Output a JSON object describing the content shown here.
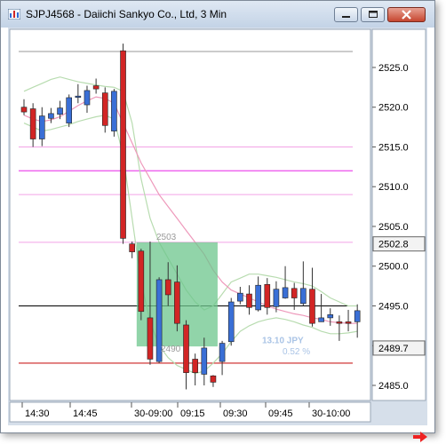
{
  "window": {
    "title": "SJPJ4568 - Daiichi Sankyo Co., Ltd, 3 Min"
  },
  "icons": {
    "app": "chart-icon",
    "minimize": "minimize-icon",
    "maximize": "maximize-icon",
    "close": "close-icon",
    "scroll_right": "arrow-right-icon"
  },
  "colors": {
    "up_candle": "#3a6fd6",
    "down_candle": "#d22525",
    "moving_average": "#ee99bb",
    "band": "#b8dcb0",
    "highlight_box": "#6cc58c",
    "resistance_line": "#ee66ee",
    "support_line": "#cc2222",
    "current_price_line": "#000000",
    "arrow": "#ee2222"
  },
  "price_axis": {
    "labels": [
      "2525.0",
      "2520.0",
      "2515.0",
      "2510.0",
      "2505.0",
      "2500.0",
      "2495.0",
      "2490.0",
      "2485.0"
    ],
    "current_price_label": "2502.8",
    "second_price_label": "2489.7"
  },
  "time_axis": {
    "labels": [
      "14:30",
      "14:45",
      "30-09:00",
      "09:15",
      "09:30",
      "09:45",
      "30-10:00"
    ]
  },
  "annotations": {
    "level_label": "2503",
    "box_low_label": "2490",
    "measure_label": "13.10 JPY",
    "measure_percent": "0.52 %"
  },
  "chart_data": {
    "type": "candlestick",
    "title": "SJPJ4568 - Daiichi Sankyo Co., Ltd, 3 Min",
    "xlabel": "",
    "ylabel": "",
    "ylim": [
      2483.1,
      2529.8
    ],
    "y_ticks": [
      2485,
      2490,
      2495,
      2500,
      2505,
      2510,
      2515,
      2520,
      2525
    ],
    "x_tick_labels": [
      "14:30",
      "14:45",
      "30-09:00",
      "09:15",
      "09:30",
      "09:45",
      "30-10:00"
    ],
    "candles": [
      {
        "o": 2520.0,
        "h": 2521.0,
        "l": 2519.0,
        "c": 2519.4
      },
      {
        "o": 2519.8,
        "h": 2520.5,
        "l": 2515.0,
        "c": 2516.0
      },
      {
        "o": 2516.0,
        "h": 2520.0,
        "l": 2515.1,
        "c": 2518.9
      },
      {
        "o": 2518.6,
        "h": 2519.9,
        "l": 2518.0,
        "c": 2519.2
      },
      {
        "o": 2519.1,
        "h": 2520.8,
        "l": 2518.5,
        "c": 2519.9
      },
      {
        "o": 2518.0,
        "h": 2521.6,
        "l": 2517.5,
        "c": 2521.2
      },
      {
        "o": 2521.4,
        "h": 2522.9,
        "l": 2520.5,
        "c": 2521.4
      },
      {
        "o": 2520.3,
        "h": 2522.7,
        "l": 2519.3,
        "c": 2522.1
      },
      {
        "o": 2522.7,
        "h": 2523.6,
        "l": 2521.7,
        "c": 2522.3
      },
      {
        "o": 2521.8,
        "h": 2522.5,
        "l": 2516.8,
        "c": 2517.7
      },
      {
        "o": 2517.0,
        "h": 2522.3,
        "l": 2516.3,
        "c": 2522.0
      },
      {
        "o": 2527.1,
        "h": 2528.0,
        "l": 2502.8,
        "c": 2503.5
      },
      {
        "o": 2502.8,
        "h": 2503.1,
        "l": 2501.0,
        "c": 2501.8
      },
      {
        "o": 2501.9,
        "h": 2502.2,
        "l": 2493.2,
        "c": 2494.3
      },
      {
        "o": 2493.5,
        "h": 2503.1,
        "l": 2487.6,
        "c": 2488.3
      },
      {
        "o": 2488.0,
        "h": 2498.6,
        "l": 2487.8,
        "c": 2498.3
      },
      {
        "o": 2498.3,
        "h": 2500.5,
        "l": 2495.0,
        "c": 2496.4
      },
      {
        "o": 2498.0,
        "h": 2500.1,
        "l": 2491.8,
        "c": 2492.8
      },
      {
        "o": 2492.6,
        "h": 2493.2,
        "l": 2484.5,
        "c": 2486.6
      },
      {
        "o": 2488.3,
        "h": 2489.0,
        "l": 2485.0,
        "c": 2486.6
      },
      {
        "o": 2486.4,
        "h": 2491.0,
        "l": 2485.0,
        "c": 2489.7
      },
      {
        "o": 2486.2,
        "h": 2486.3,
        "l": 2484.8,
        "c": 2485.4
      },
      {
        "o": 2488.0,
        "h": 2490.6,
        "l": 2486.3,
        "c": 2490.3
      },
      {
        "o": 2490.5,
        "h": 2496.0,
        "l": 2490.0,
        "c": 2495.5
      },
      {
        "o": 2495.6,
        "h": 2497.4,
        "l": 2495.2,
        "c": 2496.6
      },
      {
        "o": 2496.5,
        "h": 2497.6,
        "l": 2493.9,
        "c": 2494.8
      },
      {
        "o": 2494.5,
        "h": 2498.7,
        "l": 2494.3,
        "c": 2497.6
      },
      {
        "o": 2497.7,
        "h": 2498.5,
        "l": 2493.9,
        "c": 2494.8
      },
      {
        "o": 2494.9,
        "h": 2498.1,
        "l": 2494.2,
        "c": 2497.1
      },
      {
        "o": 2496.0,
        "h": 2500.0,
        "l": 2495.9,
        "c": 2497.3
      },
      {
        "o": 2497.2,
        "h": 2497.9,
        "l": 2494.5,
        "c": 2496.0
      },
      {
        "o": 2495.3,
        "h": 2500.6,
        "l": 2495.0,
        "c": 2497.2
      },
      {
        "o": 2497.1,
        "h": 2499.8,
        "l": 2492.4,
        "c": 2492.8
      },
      {
        "o": 2493.0,
        "h": 2496.5,
        "l": 2493.0,
        "c": 2493.5
      },
      {
        "o": 2493.5,
        "h": 2494.7,
        "l": 2492.5,
        "c": 2493.9
      },
      {
        "o": 2493.0,
        "h": 2493.8,
        "l": 2490.6,
        "c": 2492.8
      },
      {
        "o": 2493.0,
        "h": 2494.5,
        "l": 2491.8,
        "c": 2492.8
      },
      {
        "o": 2493.0,
        "h": 2495.2,
        "l": 2491.0,
        "c": 2494.4
      }
    ],
    "moving_average": [
      2519.0,
      2518.5,
      2518.2,
      2518.4,
      2518.8,
      2519.5,
      2520.2,
      2520.8,
      2521.3,
      2521.1,
      2520.5,
      2518.0,
      2515.5,
      2513.0,
      2511.0,
      2509.0,
      2507.5,
      2506.0,
      2504.5,
      2503.0,
      2501.5,
      2499.5,
      2498.0,
      2497.0,
      2496.5,
      2496.0,
      2495.5,
      2495.0,
      2494.6,
      2494.3,
      2494.0,
      2493.8,
      2493.5,
      2493.3,
      2493.0,
      2492.9,
      2492.8,
      2492.8
    ],
    "band_upper": [
      2522.0,
      2522.5,
      2523.0,
      2523.5,
      2523.8,
      2523.5,
      2523.2,
      2523.0,
      2522.8,
      2522.6,
      2522.5,
      2522.0,
      2518.0,
      2511.0,
      2506.0,
      2503.0,
      2501.0,
      2499.0,
      2497.0,
      2495.5,
      2494.5,
      2495.0,
      2496.5,
      2498.0,
      2498.5,
      2499.0,
      2499.0,
      2498.8,
      2498.6,
      2498.3,
      2498.0,
      2497.8,
      2497.5,
      2496.8,
      2496.0,
      2495.5,
      2495.0,
      2495.0
    ],
    "band_lower": [
      2518.0,
      2517.5,
      2517.0,
      2517.2,
      2517.5,
      2517.8,
      2518.2,
      2518.5,
      2518.8,
      2519.0,
      2518.5,
      2514.0,
      2506.0,
      2498.0,
      2493.0,
      2490.0,
      2488.5,
      2487.5,
      2487.0,
      2486.5,
      2486.8,
      2487.8,
      2489.0,
      2490.5,
      2491.8,
      2492.5,
      2493.0,
      2493.3,
      2493.5,
      2493.3,
      2493.0,
      2492.6,
      2492.3,
      2491.8,
      2491.5,
      2491.5,
      2491.6,
      2491.8
    ],
    "horizontal_lines": [
      {
        "price": 2527.0,
        "style": "gray"
      },
      {
        "price": 2515.0,
        "style": "dashed-pink"
      },
      {
        "price": 2512.0,
        "style": "solid-magenta"
      },
      {
        "price": 2509.0,
        "style": "dashed-pink"
      },
      {
        "price": 2503.0,
        "style": "dashed-pink"
      },
      {
        "price": 2495.0,
        "style": "solid-black"
      },
      {
        "price": 2487.8,
        "style": "solid-red"
      }
    ],
    "highlight_box": {
      "start_index": 13,
      "end_index": 21,
      "high": 2503.0,
      "low": 2489.9
    }
  }
}
